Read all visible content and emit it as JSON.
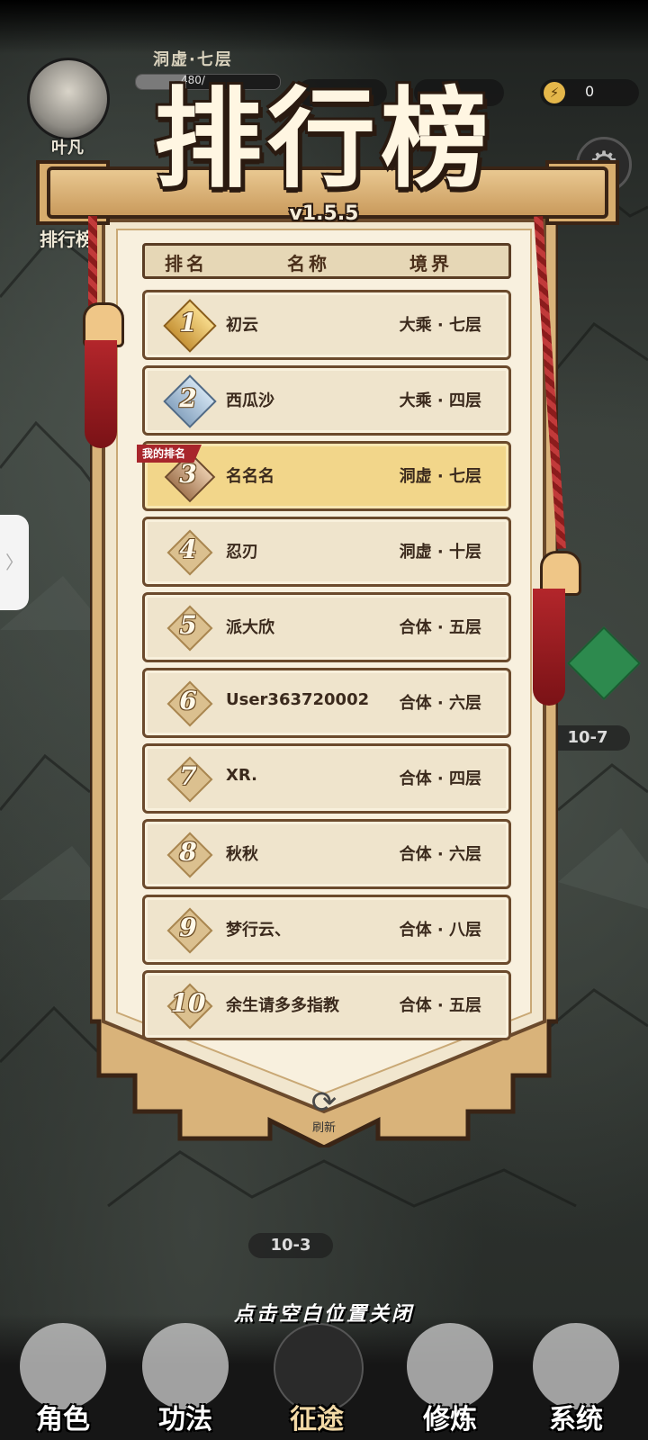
{
  "player": {
    "name": "叶凡",
    "level_text": "洞虚·七层",
    "exp_text": "480/",
    "exp_fraction": 0.35
  },
  "resources": {
    "energy": "0"
  },
  "sidebar": {
    "rank_label": "排行榜"
  },
  "map": {
    "node_upper": "10-7",
    "node_lower": "10-3"
  },
  "leaderboard": {
    "title": "排行榜",
    "version": "v1.5.5",
    "headers": {
      "rank": "排名",
      "name": "名称",
      "realm": "境界"
    },
    "my_rank_tag": "我的排名",
    "rows": [
      {
        "rank": "1",
        "name": "初云",
        "realm": "大乘 · 七层"
      },
      {
        "rank": "2",
        "name": "西瓜沙",
        "realm": "大乘 · 四层"
      },
      {
        "rank": "3",
        "name": "名名名",
        "realm": "洞虚 · 七层"
      },
      {
        "rank": "4",
        "name": "忍刃",
        "realm": "洞虚 · 十层"
      },
      {
        "rank": "5",
        "name": "派大欣",
        "realm": "合体 · 五层"
      },
      {
        "rank": "6",
        "name": "User363720002",
        "realm": "合体 · 六层"
      },
      {
        "rank": "7",
        "name": "XR.",
        "realm": "合体 · 四层"
      },
      {
        "rank": "8",
        "name": "秋秋",
        "realm": "合体 · 六层"
      },
      {
        "rank": "9",
        "name": "梦行云、",
        "realm": "合体 · 八层"
      },
      {
        "rank": "10",
        "name": "余生请多多指教",
        "realm": "合体 · 五层"
      }
    ],
    "refresh_label": "刷新",
    "close_hint": "点击空白位置关闭"
  },
  "nav": [
    {
      "label": "角色",
      "icon": "character-icon"
    },
    {
      "label": "功法",
      "icon": "scripture-icon"
    },
    {
      "label": "征途",
      "icon": "journey-icon"
    },
    {
      "label": "修炼",
      "icon": "cultivate-icon"
    },
    {
      "label": "系统",
      "icon": "system-icon"
    }
  ],
  "colors": {
    "gold": "#f2d68a",
    "banner_red": "#a8262c",
    "paper": "#efe4cc",
    "ink": "#3b2a1d"
  }
}
